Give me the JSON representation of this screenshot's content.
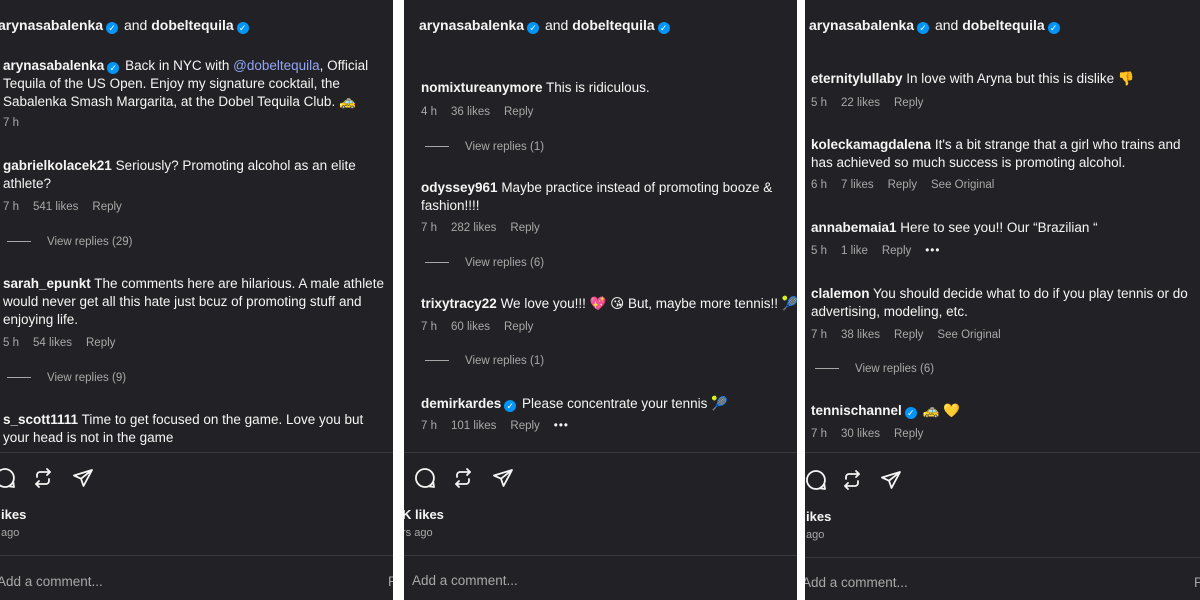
{
  "header": {
    "user1": "arynasabalenka",
    "and": "and",
    "user2": "dobeltequila"
  },
  "post": {
    "user": "arynasabalenka",
    "text_pre": " Back in NYC with ",
    "mention": "@dobeltequila",
    "text_post": ", Official Tequila of the US Open. Enjoy my signature cocktail, the Sabalenka Smash Margarita, at the Dobel Tequila Club. 🚕",
    "time": "7 h"
  },
  "panel1": {
    "comments": [
      {
        "user": "gabrielkolacek21",
        "text": " Seriously? Promoting alcohol as an elite athlete?",
        "time": "7 h",
        "likes": "541 likes",
        "reply": "Reply",
        "view_replies": "View replies (29)"
      },
      {
        "user": "sarah_epunkt",
        "text": " The comments here are hilarious. A male athlete would never get all this hate just bcuz of promoting stuff and enjoying life.",
        "time": "5 h",
        "likes": "54 likes",
        "reply": "Reply",
        "view_replies": "View replies (9)"
      },
      {
        "user": "s_scott1111",
        "text": " Time to get focused on the game. Love you but your head is not in the game"
      }
    ],
    "likes_label": "ikes",
    "ago": "ago",
    "add_comment": "Add a comment...",
    "post_trunc": "P"
  },
  "panel2": {
    "comments": [
      {
        "user": "nomixtureanymore",
        "text": " This is ridiculous.",
        "time": "4 h",
        "likes": "36 likes",
        "reply": "Reply",
        "view_replies": "View replies (1)"
      },
      {
        "user": "odyssey961",
        "text": " Maybe practice instead of promoting booze & fashion!!!!",
        "time": "7 h",
        "likes": "282 likes",
        "reply": "Reply",
        "view_replies": "View replies (6)"
      },
      {
        "user": "trixytracy22",
        "text": " We love you!!! 💖 😘 But, maybe more tennis!! 🎾",
        "time": "7 h",
        "likes": "60 likes",
        "reply": "Reply",
        "view_replies": "View replies (1)"
      },
      {
        "user": "demirkardes",
        "text": " Please concentrate your tennis 🎾",
        "time": "7 h",
        "likes": "101 likes",
        "reply": "Reply",
        "more": "•••"
      }
    ],
    "likes_label": "K likes",
    "ago": "rs ago",
    "add_comment": "Add a comment..."
  },
  "panel3": {
    "comments": [
      {
        "user": "eternitylullaby",
        "text": " In love with Aryna but this is dislike 👎",
        "time": "5 h",
        "likes": "22 likes",
        "reply": "Reply"
      },
      {
        "user": "koleckamagdalena",
        "text": " It's a bit strange that a girl who trains and has achieved so much success is promoting alcohol.",
        "time": "6 h",
        "likes": "7 likes",
        "reply": "Reply",
        "see_original": "See Original"
      },
      {
        "user": "annabemaia1",
        "text": " Here to see you!! Our “Brazilian “",
        "time": "5 h",
        "likes": "1 like",
        "reply": "Reply",
        "more": "•••"
      },
      {
        "user": "clalemon",
        "text": " You should decide what to do if you play tennis or do advertising, modeling, etc.",
        "time": "7 h",
        "likes": "38 likes",
        "reply": "Reply",
        "see_original": "See Original",
        "view_replies": "View replies (6)"
      },
      {
        "user": "tennischannel",
        "text": " 🚕 💛",
        "time": "7 h",
        "likes": "30 likes",
        "reply": "Reply"
      }
    ],
    "likes_label": "ikes",
    "ago": "ago",
    "add_comment": "Add a comment...",
    "post_trunc": "P"
  },
  "icons": [
    "comment-icon",
    "repost-icon",
    "share-icon",
    "verified-icon"
  ],
  "colors": {
    "background": "#222226",
    "verified": "#0095f6",
    "mention": "#93a5f5",
    "meta": "#a8a8a8"
  }
}
